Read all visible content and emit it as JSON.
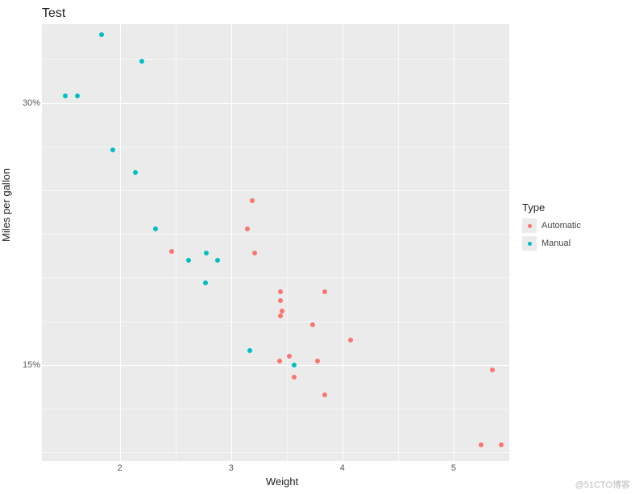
{
  "chart_data": {
    "type": "scatter",
    "title": "Test",
    "xlabel": "Weight",
    "ylabel": "Miles per gallon",
    "x_ticks": [
      2,
      3,
      4,
      5
    ],
    "y_ticks": [
      {
        "value": 15,
        "label": "15%"
      },
      {
        "value": 30,
        "label": "30%"
      }
    ],
    "xlim": [
      1.3,
      5.5
    ],
    "ylim": [
      9.5,
      34.5
    ],
    "legend_title": "Type",
    "series": [
      {
        "name": "Automatic",
        "color": "#F8766D",
        "points": [
          {
            "x": 3.215,
            "y": 21.4
          },
          {
            "x": 3.44,
            "y": 18.7
          },
          {
            "x": 3.46,
            "y": 18.1
          },
          {
            "x": 3.57,
            "y": 14.3
          },
          {
            "x": 3.19,
            "y": 24.4
          },
          {
            "x": 3.15,
            "y": 22.8
          },
          {
            "x": 3.44,
            "y": 19.2
          },
          {
            "x": 3.44,
            "y": 17.8
          },
          {
            "x": 4.07,
            "y": 16.4
          },
          {
            "x": 3.73,
            "y": 17.3
          },
          {
            "x": 3.78,
            "y": 15.2
          },
          {
            "x": 5.25,
            "y": 10.4
          },
          {
            "x": 5.424,
            "y": 10.4
          },
          {
            "x": 5.345,
            "y": 14.7
          },
          {
            "x": 2.465,
            "y": 21.5
          },
          {
            "x": 3.52,
            "y": 15.5
          },
          {
            "x": 3.435,
            "y": 15.2
          },
          {
            "x": 3.84,
            "y": 13.3
          },
          {
            "x": 3.845,
            "y": 19.2
          }
        ]
      },
      {
        "name": "Manual",
        "color": "#00BFC4",
        "points": [
          {
            "x": 2.62,
            "y": 21.0
          },
          {
            "x": 2.875,
            "y": 21.0
          },
          {
            "x": 2.32,
            "y": 22.8
          },
          {
            "x": 2.2,
            "y": 32.4
          },
          {
            "x": 1.615,
            "y": 30.4
          },
          {
            "x": 1.835,
            "y": 33.9
          },
          {
            "x": 1.935,
            "y": 27.3
          },
          {
            "x": 2.14,
            "y": 26.0
          },
          {
            "x": 1.513,
            "y": 30.4
          },
          {
            "x": 3.17,
            "y": 15.8
          },
          {
            "x": 2.77,
            "y": 19.7
          },
          {
            "x": 3.57,
            "y": 15.0
          },
          {
            "x": 2.78,
            "y": 21.4
          }
        ]
      }
    ]
  },
  "watermark": "@51CTO博客"
}
